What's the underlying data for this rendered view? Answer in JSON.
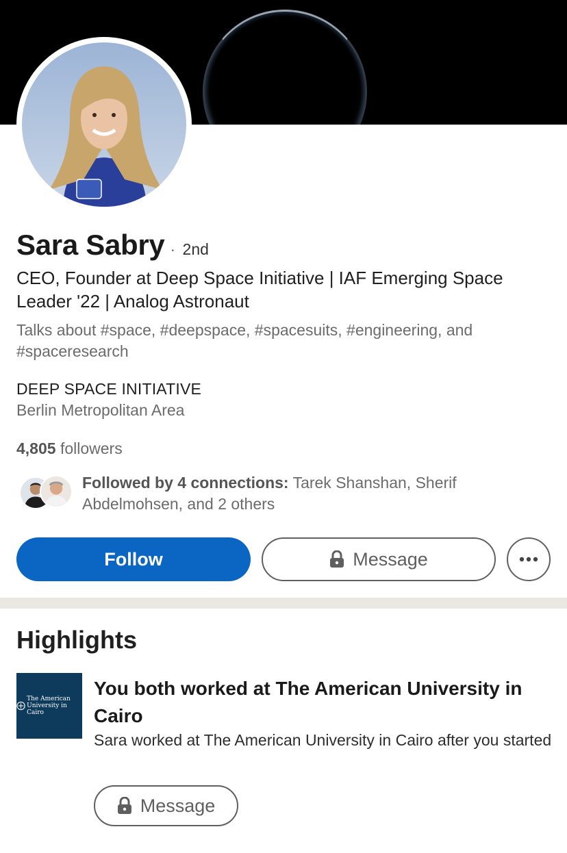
{
  "profile": {
    "name": "Sara Sabry",
    "degree_separator": "·",
    "degree": "2nd",
    "headline": "CEO, Founder at Deep Space Initiative | IAF Emerging Space Leader '22 | Analog Astronaut",
    "talks_about": "Talks about #space, #deepspace, #spacesuits, #engineering, and #spaceresearch",
    "company": "DEEP SPACE INITIATIVE",
    "location": "Berlin Metropolitan Area",
    "followers_count": "4,805",
    "followers_label": "followers",
    "mutual_bold": "Followed by 4 connections:",
    "mutual_rest": " Tarek Shanshan, Sherif Abdelmohsen, and 2 others"
  },
  "actions": {
    "follow_label": "Follow",
    "message_label": "Message",
    "more_icon": "ellipsis-icon",
    "lock_icon": "lock-icon"
  },
  "highlights": {
    "title": "Highlights",
    "logo_text_line1": "The American",
    "logo_text_line2": "University in Cairo",
    "heading": "You both worked at The American University in Cairo",
    "description": "Sara worked at The American University in Cairo after you started",
    "message_label": "Message"
  },
  "colors": {
    "primary": "#0a66c2",
    "logo_bg": "#0e3a5c",
    "divider": "#ebe7e2"
  }
}
